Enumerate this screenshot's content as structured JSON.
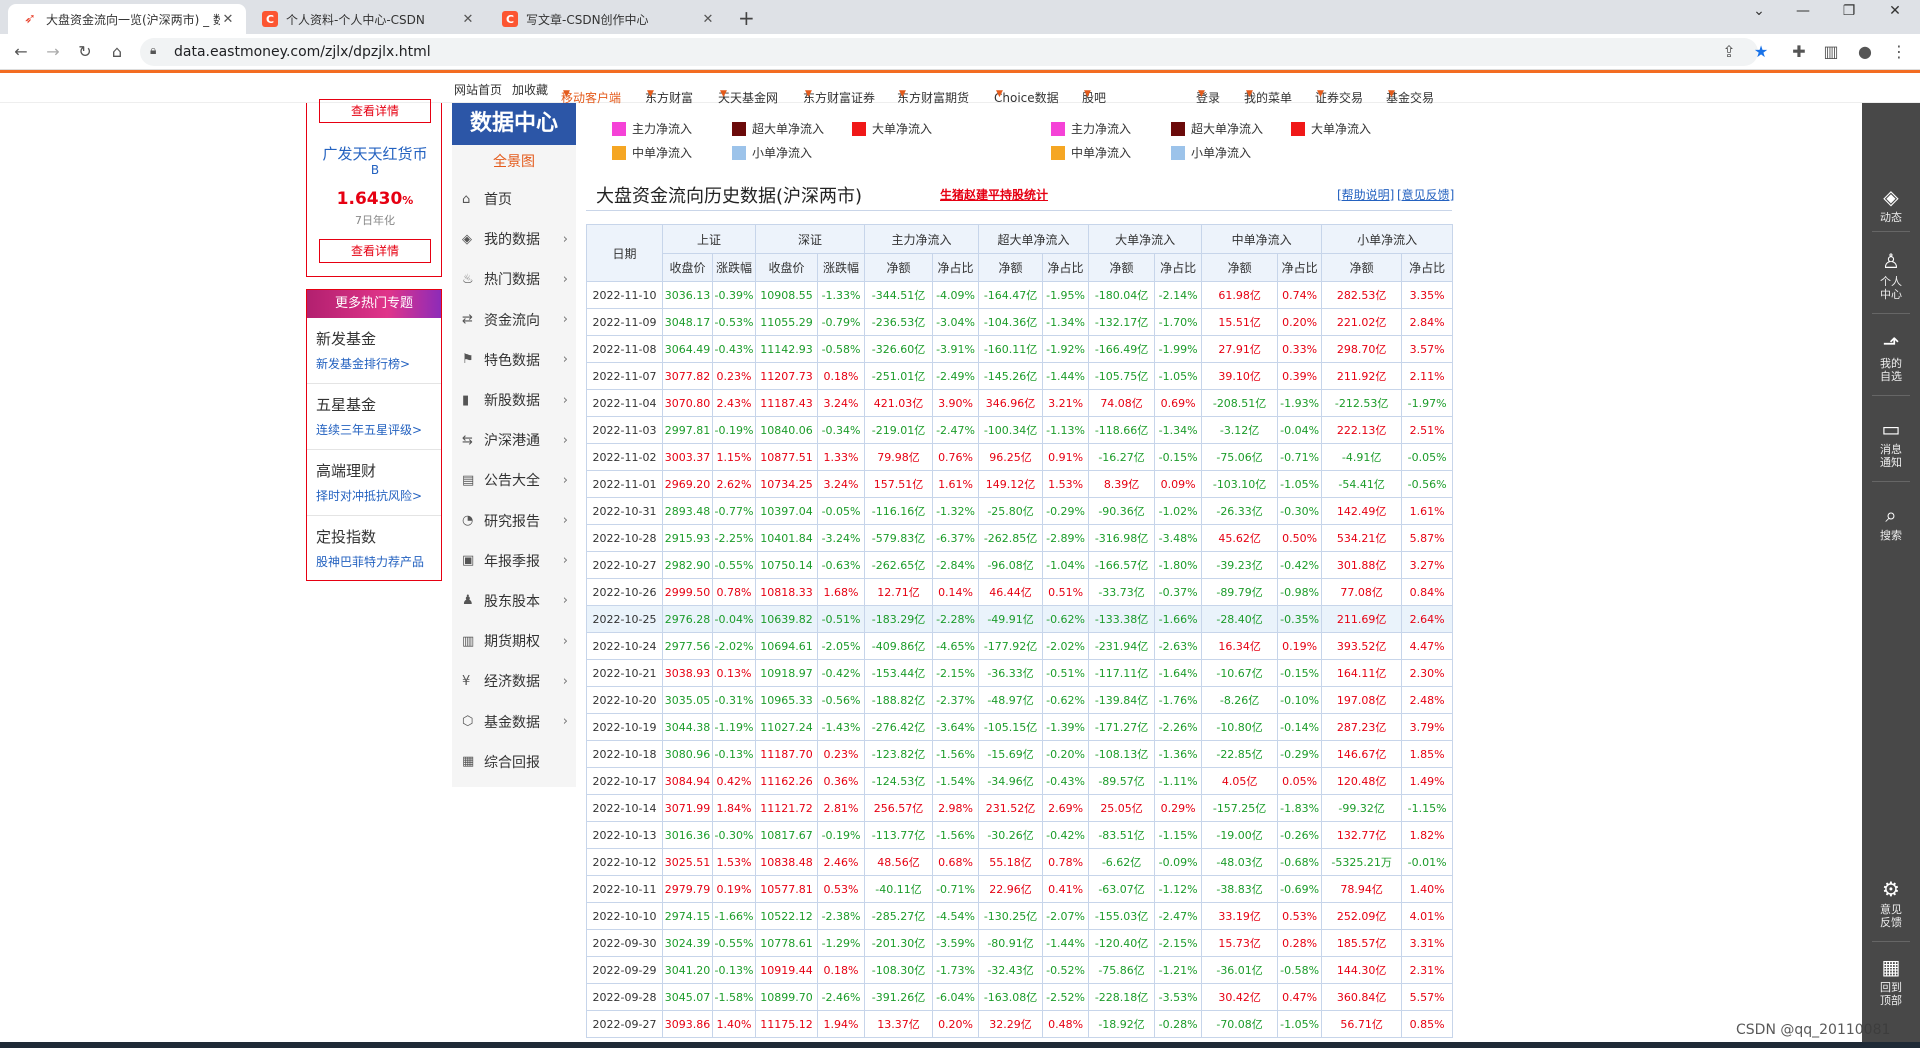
{
  "browser": {
    "tabs": [
      {
        "title": "大盘资金流向一览(沪深两市) _ 数",
        "active": true
      },
      {
        "title": "个人资料-个人中心-CSDN",
        "active": false
      },
      {
        "title": "写文章-CSDN创作中心",
        "active": false
      }
    ],
    "url": "data.eastmoney.com/zjlx/dpzjlx.html"
  },
  "sitenav": {
    "left": [
      "网站首页",
      "加收藏",
      "移动客户端",
      "东方财富",
      "天天基金网",
      "东方财富证券",
      "东方财富期货",
      "Choice数据",
      "股吧"
    ],
    "right": [
      "登录",
      "我的菜单",
      "证券交易",
      "基金交易"
    ]
  },
  "ad": {
    "detail_label": "查看详情",
    "fund_name": "广发天天红货币",
    "fund_class": "B",
    "rate": "1.6430",
    "rate_unit": "%",
    "rate_note": "7日年化",
    "hot_title": "更多热门专题",
    "hot_items": [
      {
        "title": "新发基金",
        "link": "新发基金排行榜>"
      },
      {
        "title": "五星基金",
        "link": "连续三年五星评级>"
      },
      {
        "title": "高端理财",
        "link": "择时对冲抵抗风险>"
      },
      {
        "title": "定投指数",
        "link": "股神巴菲特力荐产品"
      }
    ]
  },
  "dcnav": {
    "title": "数据中心",
    "all": "全景图",
    "items": [
      "首页",
      "我的数据",
      "热门数据",
      "资金流向",
      "特色数据",
      "新股数据",
      "沪深港通",
      "公告大全",
      "研究报告",
      "年报季报",
      "股东股本",
      "期货期权",
      "经济数据",
      "基金数据",
      "综合回报"
    ]
  },
  "legend": [
    {
      "label": "主力净流入",
      "color": "#f542d7"
    },
    {
      "label": "超大单净流入",
      "color": "#6b0a0a"
    },
    {
      "label": "大单净流入",
      "color": "#f01818"
    },
    {
      "label": "中单净流入",
      "color": "#f5a623"
    },
    {
      "label": "小单净流入",
      "color": "#9cc3ea"
    }
  ],
  "page": {
    "title": "大盘资金流向历史数据(沪深两市)",
    "link": "生猪赵建平持股统计",
    "help": "[帮助说明]",
    "feedback": "[意见反馈]"
  },
  "table": {
    "date_header": "日期",
    "groups": [
      "上证",
      "深证",
      "主力净流入",
      "超大单净流入",
      "大单净流入",
      "中单净流入",
      "小单净流入"
    ],
    "sub": [
      "收盘价",
      "涨跌幅",
      "收盘价",
      "涨跌幅",
      "净额",
      "净占比",
      "净额",
      "净占比",
      "净额",
      "净占比",
      "净额",
      "净占比",
      "净额",
      "净占比"
    ],
    "rows": [
      [
        "2022-11-10",
        "3036.13",
        "-0.39%",
        "10908.55",
        "-1.33%",
        "-344.51亿",
        "-4.09%",
        "-164.47亿",
        "-1.95%",
        "-180.04亿",
        "-2.14%",
        "61.98亿",
        "0.74%",
        "282.53亿",
        "3.35%"
      ],
      [
        "2022-11-09",
        "3048.17",
        "-0.53%",
        "11055.29",
        "-0.79%",
        "-236.53亿",
        "-3.04%",
        "-104.36亿",
        "-1.34%",
        "-132.17亿",
        "-1.70%",
        "15.51亿",
        "0.20%",
        "221.02亿",
        "2.84%"
      ],
      [
        "2022-11-08",
        "3064.49",
        "-0.43%",
        "11142.93",
        "-0.58%",
        "-326.60亿",
        "-3.91%",
        "-160.11亿",
        "-1.92%",
        "-166.49亿",
        "-1.99%",
        "27.91亿",
        "0.33%",
        "298.70亿",
        "3.57%"
      ],
      [
        "2022-11-07",
        "3077.82",
        "0.23%",
        "11207.73",
        "0.18%",
        "-251.01亿",
        "-2.49%",
        "-145.26亿",
        "-1.44%",
        "-105.75亿",
        "-1.05%",
        "39.10亿",
        "0.39%",
        "211.92亿",
        "2.11%"
      ],
      [
        "2022-11-04",
        "3070.80",
        "2.43%",
        "11187.43",
        "3.24%",
        "421.03亿",
        "3.90%",
        "346.96亿",
        "3.21%",
        "74.08亿",
        "0.69%",
        "-208.51亿",
        "-1.93%",
        "-212.53亿",
        "-1.97%"
      ],
      [
        "2022-11-03",
        "2997.81",
        "-0.19%",
        "10840.06",
        "-0.34%",
        "-219.01亿",
        "-2.47%",
        "-100.34亿",
        "-1.13%",
        "-118.66亿",
        "-1.34%",
        "-3.12亿",
        "-0.04%",
        "222.13亿",
        "2.51%"
      ],
      [
        "2022-11-02",
        "3003.37",
        "1.15%",
        "10877.51",
        "1.33%",
        "79.98亿",
        "0.76%",
        "96.25亿",
        "0.91%",
        "-16.27亿",
        "-0.15%",
        "-75.06亿",
        "-0.71%",
        "-4.91亿",
        "-0.05%"
      ],
      [
        "2022-11-01",
        "2969.20",
        "2.62%",
        "10734.25",
        "3.24%",
        "157.51亿",
        "1.61%",
        "149.12亿",
        "1.53%",
        "8.39亿",
        "0.09%",
        "-103.10亿",
        "-1.05%",
        "-54.41亿",
        "-0.56%"
      ],
      [
        "2022-10-31",
        "2893.48",
        "-0.77%",
        "10397.04",
        "-0.05%",
        "-116.16亿",
        "-1.32%",
        "-25.80亿",
        "-0.29%",
        "-90.36亿",
        "-1.02%",
        "-26.33亿",
        "-0.30%",
        "142.49亿",
        "1.61%"
      ],
      [
        "2022-10-28",
        "2915.93",
        "-2.25%",
        "10401.84",
        "-3.24%",
        "-579.83亿",
        "-6.37%",
        "-262.85亿",
        "-2.89%",
        "-316.98亿",
        "-3.48%",
        "45.62亿",
        "0.50%",
        "534.21亿",
        "5.87%"
      ],
      [
        "2022-10-27",
        "2982.90",
        "-0.55%",
        "10750.14",
        "-0.63%",
        "-262.65亿",
        "-2.84%",
        "-96.08亿",
        "-1.04%",
        "-166.57亿",
        "-1.80%",
        "-39.23亿",
        "-0.42%",
        "301.88亿",
        "3.27%"
      ],
      [
        "2022-10-26",
        "2999.50",
        "0.78%",
        "10818.33",
        "1.68%",
        "12.71亿",
        "0.14%",
        "46.44亿",
        "0.51%",
        "-33.73亿",
        "-0.37%",
        "-89.79亿",
        "-0.98%",
        "77.08亿",
        "0.84%"
      ],
      [
        "2022-10-25",
        "2976.28",
        "-0.04%",
        "10639.82",
        "-0.51%",
        "-183.29亿",
        "-2.28%",
        "-49.91亿",
        "-0.62%",
        "-133.38亿",
        "-1.66%",
        "-28.40亿",
        "-0.35%",
        "211.69亿",
        "2.64%"
      ],
      [
        "2022-10-24",
        "2977.56",
        "-2.02%",
        "10694.61",
        "-2.05%",
        "-409.86亿",
        "-4.65%",
        "-177.92亿",
        "-2.02%",
        "-231.94亿",
        "-2.63%",
        "16.34亿",
        "0.19%",
        "393.52亿",
        "4.47%"
      ],
      [
        "2022-10-21",
        "3038.93",
        "0.13%",
        "10918.97",
        "-0.42%",
        "-153.44亿",
        "-2.15%",
        "-36.33亿",
        "-0.51%",
        "-117.11亿",
        "-1.64%",
        "-10.67亿",
        "-0.15%",
        "164.11亿",
        "2.30%"
      ],
      [
        "2022-10-20",
        "3035.05",
        "-0.31%",
        "10965.33",
        "-0.56%",
        "-188.82亿",
        "-2.37%",
        "-48.97亿",
        "-0.62%",
        "-139.84亿",
        "-1.76%",
        "-8.26亿",
        "-0.10%",
        "197.08亿",
        "2.48%"
      ],
      [
        "2022-10-19",
        "3044.38",
        "-1.19%",
        "11027.24",
        "-1.43%",
        "-276.42亿",
        "-3.64%",
        "-105.15亿",
        "-1.39%",
        "-171.27亿",
        "-2.26%",
        "-10.80亿",
        "-0.14%",
        "287.23亿",
        "3.79%"
      ],
      [
        "2022-10-18",
        "3080.96",
        "-0.13%",
        "11187.70",
        "0.23%",
        "-123.82亿",
        "-1.56%",
        "-15.69亿",
        "-0.20%",
        "-108.13亿",
        "-1.36%",
        "-22.85亿",
        "-0.29%",
        "146.67亿",
        "1.85%"
      ],
      [
        "2022-10-17",
        "3084.94",
        "0.42%",
        "11162.26",
        "0.36%",
        "-124.53亿",
        "-1.54%",
        "-34.96亿",
        "-0.43%",
        "-89.57亿",
        "-1.11%",
        "4.05亿",
        "0.05%",
        "120.48亿",
        "1.49%"
      ],
      [
        "2022-10-14",
        "3071.99",
        "1.84%",
        "11121.72",
        "2.81%",
        "256.57亿",
        "2.98%",
        "231.52亿",
        "2.69%",
        "25.05亿",
        "0.29%",
        "-157.25亿",
        "-1.83%",
        "-99.32亿",
        "-1.15%"
      ],
      [
        "2022-10-13",
        "3016.36",
        "-0.30%",
        "10817.67",
        "-0.19%",
        "-113.77亿",
        "-1.56%",
        "-30.26亿",
        "-0.42%",
        "-83.51亿",
        "-1.15%",
        "-19.00亿",
        "-0.26%",
        "132.77亿",
        "1.82%"
      ],
      [
        "2022-10-12",
        "3025.51",
        "1.53%",
        "10838.48",
        "2.46%",
        "48.56亿",
        "0.68%",
        "55.18亿",
        "0.78%",
        "-6.62亿",
        "-0.09%",
        "-48.03亿",
        "-0.68%",
        "-5325.21万",
        "-0.01%"
      ],
      [
        "2022-10-11",
        "2979.79",
        "0.19%",
        "10577.81",
        "0.53%",
        "-40.11亿",
        "-0.71%",
        "22.96亿",
        "0.41%",
        "-63.07亿",
        "-1.12%",
        "-38.83亿",
        "-0.69%",
        "78.94亿",
        "1.40%"
      ],
      [
        "2022-10-10",
        "2974.15",
        "-1.66%",
        "10522.12",
        "-2.38%",
        "-285.27亿",
        "-4.54%",
        "-130.25亿",
        "-2.07%",
        "-155.03亿",
        "-2.47%",
        "33.19亿",
        "0.53%",
        "252.09亿",
        "4.01%"
      ],
      [
        "2022-09-30",
        "3024.39",
        "-0.55%",
        "10778.61",
        "-1.29%",
        "-201.30亿",
        "-3.59%",
        "-80.91亿",
        "-1.44%",
        "-120.40亿",
        "-2.15%",
        "15.73亿",
        "0.28%",
        "185.57亿",
        "3.31%"
      ],
      [
        "2022-09-29",
        "3041.20",
        "-0.13%",
        "10919.44",
        "0.18%",
        "-108.30亿",
        "-1.73%",
        "-32.43亿",
        "-0.52%",
        "-75.86亿",
        "-1.21%",
        "-36.01亿",
        "-0.58%",
        "144.30亿",
        "2.31%"
      ],
      [
        "2022-09-28",
        "3045.07",
        "-1.58%",
        "10899.70",
        "-2.46%",
        "-391.26亿",
        "-6.04%",
        "-163.08亿",
        "-2.52%",
        "-228.18亿",
        "-3.53%",
        "30.42亿",
        "0.47%",
        "360.84亿",
        "5.57%"
      ],
      [
        "2022-09-27",
        "3093.86",
        "1.40%",
        "11175.12",
        "1.94%",
        "13.37亿",
        "0.20%",
        "32.29亿",
        "0.48%",
        "-18.92亿",
        "-0.28%",
        "-70.08亿",
        "-1.05%",
        "56.71亿",
        "0.85%"
      ]
    ]
  },
  "rside": [
    "动态",
    "个人中心",
    "我的自选",
    "消息通知",
    "搜索",
    "意见反馈",
    "回到顶部"
  ],
  "watermark": "CSDN @qq_20110081"
}
